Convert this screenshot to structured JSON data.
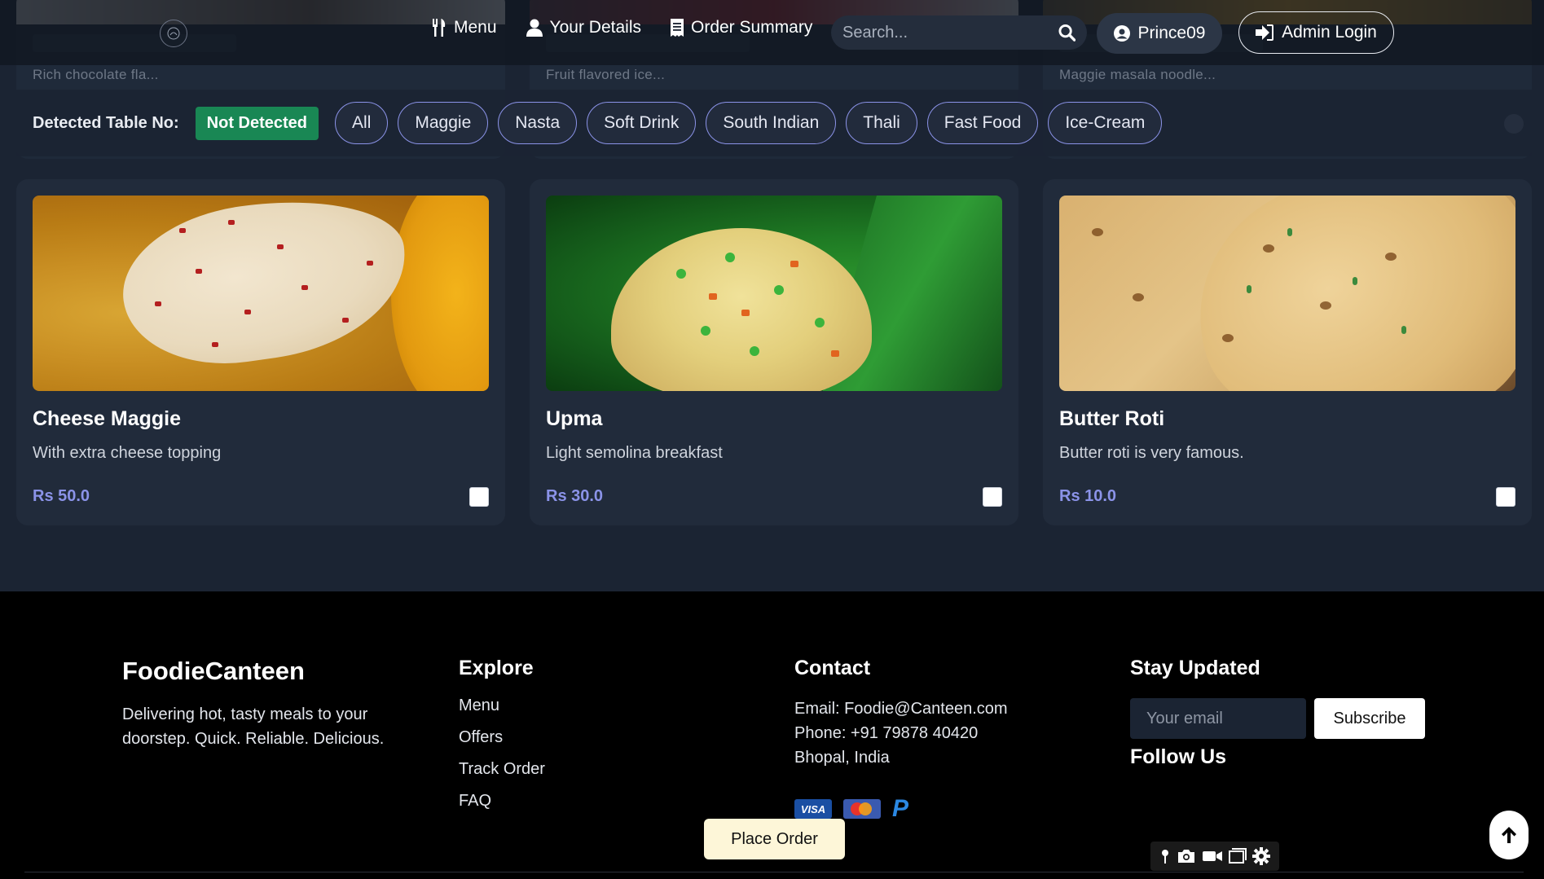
{
  "nav": {
    "menu": "Menu",
    "details": "Your Details",
    "summary": "Order Summary",
    "search_placeholder": "Search...",
    "user": "Prince09",
    "admin": "Admin Login"
  },
  "ghost_cards": [
    {
      "text": "Rich chocolate fla..."
    },
    {
      "text": "Fruit flavored ice..."
    },
    {
      "text": "Maggie masala noodle..."
    }
  ],
  "filter": {
    "table_label": "Detected Table No:",
    "table_status": "Not Detected",
    "categories": [
      "All",
      "Maggie",
      "Nasta",
      "Soft Drink",
      "South Indian",
      "Thali",
      "Fast Food",
      "Ice-Cream"
    ]
  },
  "items": [
    {
      "name": "Cheese Maggie",
      "desc": "With extra cheese topping",
      "price": "Rs 50.0",
      "image": "cheese-maggie-photo"
    },
    {
      "name": "Upma",
      "desc": "Light semolina breakfast",
      "price": "Rs 30.0",
      "image": "upma-photo"
    },
    {
      "name": "Butter Roti",
      "desc": "Butter roti is very famous.",
      "price": "Rs 10.0",
      "image": "butter-roti-photo"
    }
  ],
  "footer": {
    "brand": "FoodieCanteen",
    "tagline": "Delivering hot, tasty meals to your doorstep. Quick. Reliable. Delicious.",
    "explore_title": "Explore",
    "explore_links": [
      "Menu",
      "Offers",
      "Track Order",
      "FAQ"
    ],
    "contact_title": "Contact",
    "email": "Email: Foodie@Canteen.com",
    "phone": "Phone: +91 79878 40420",
    "location": "Bhopal, India",
    "payments": [
      "VISA",
      "mastercard",
      "PayPal"
    ],
    "stay_title": "Stay Updated",
    "email_placeholder": "Your email",
    "subscribe": "Subscribe",
    "follow_title": "Follow Us"
  },
  "place_order": "Place Order",
  "colors": {
    "accent": "#8b93e8",
    "badge": "#198754",
    "card_bg": "#212b3b",
    "page_bg": "#1b2433",
    "footer_bg": "#000000"
  }
}
